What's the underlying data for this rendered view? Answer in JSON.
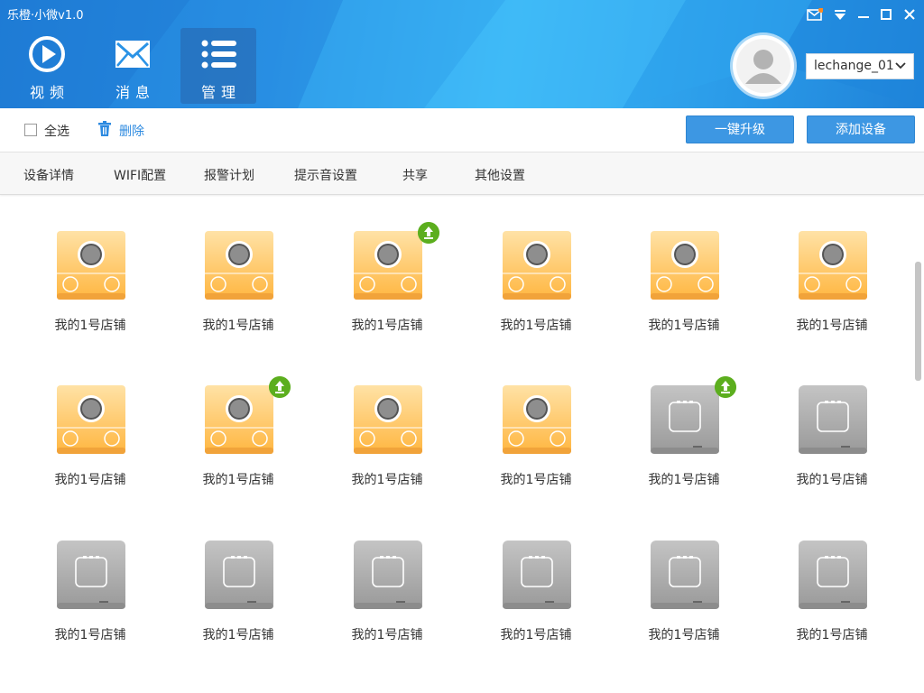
{
  "app": {
    "title": "乐橙·小微v1.0"
  },
  "window_controls": [
    {
      "name": "message-icon",
      "label": ""
    },
    {
      "name": "dropdown-menu-icon",
      "label": ""
    },
    {
      "name": "minimize-icon",
      "label": ""
    },
    {
      "name": "maximize-icon",
      "label": ""
    },
    {
      "name": "close-icon",
      "label": ""
    }
  ],
  "nav": {
    "items": [
      {
        "label": "视频",
        "icon": "play-icon",
        "active": false
      },
      {
        "label": "消息",
        "icon": "envelope-icon",
        "active": false
      },
      {
        "label": "管理",
        "icon": "list-icon",
        "active": true
      }
    ]
  },
  "user": {
    "account": "lechange_01"
  },
  "toolbar": {
    "select_all_label": "全选",
    "delete_label": "删除",
    "upgrade_all_label": "一键升级",
    "add_device_label": "添加设备"
  },
  "tabs": [
    "设备详情",
    "WIFI配置",
    "报警计划",
    "提示音设置",
    "共享",
    "其他设置"
  ],
  "devices": [
    {
      "name": "我的1号店铺",
      "status": "online",
      "upgrade": false
    },
    {
      "name": "我的1号店铺",
      "status": "online",
      "upgrade": false
    },
    {
      "name": "我的1号店铺",
      "status": "online",
      "upgrade": true
    },
    {
      "name": "我的1号店铺",
      "status": "online",
      "upgrade": false
    },
    {
      "name": "我的1号店铺",
      "status": "online",
      "upgrade": false
    },
    {
      "name": "我的1号店铺",
      "status": "online",
      "upgrade": false
    },
    {
      "name": "我的1号店铺",
      "status": "online",
      "upgrade": false
    },
    {
      "name": "我的1号店铺",
      "status": "online",
      "upgrade": true
    },
    {
      "name": "我的1号店铺",
      "status": "online",
      "upgrade": false
    },
    {
      "name": "我的1号店铺",
      "status": "online",
      "upgrade": false
    },
    {
      "name": "我的1号店铺",
      "status": "offline",
      "upgrade": true
    },
    {
      "name": "我的1号店铺",
      "status": "offline",
      "upgrade": false
    },
    {
      "name": "我的1号店铺",
      "status": "offline",
      "upgrade": false
    },
    {
      "name": "我的1号店铺",
      "status": "offline",
      "upgrade": false
    },
    {
      "name": "我的1号店铺",
      "status": "offline",
      "upgrade": false
    },
    {
      "name": "我的1号店铺",
      "status": "offline",
      "upgrade": false
    },
    {
      "name": "我的1号店铺",
      "status": "offline",
      "upgrade": false
    },
    {
      "name": "我的1号店铺",
      "status": "offline",
      "upgrade": false
    }
  ],
  "colors": {
    "accent": "#3d97e3",
    "header": "#2a93e6",
    "upgrade_badge": "#5cae1e",
    "online_device": "#ffc15a",
    "offline_device": "#a9a9a9"
  }
}
